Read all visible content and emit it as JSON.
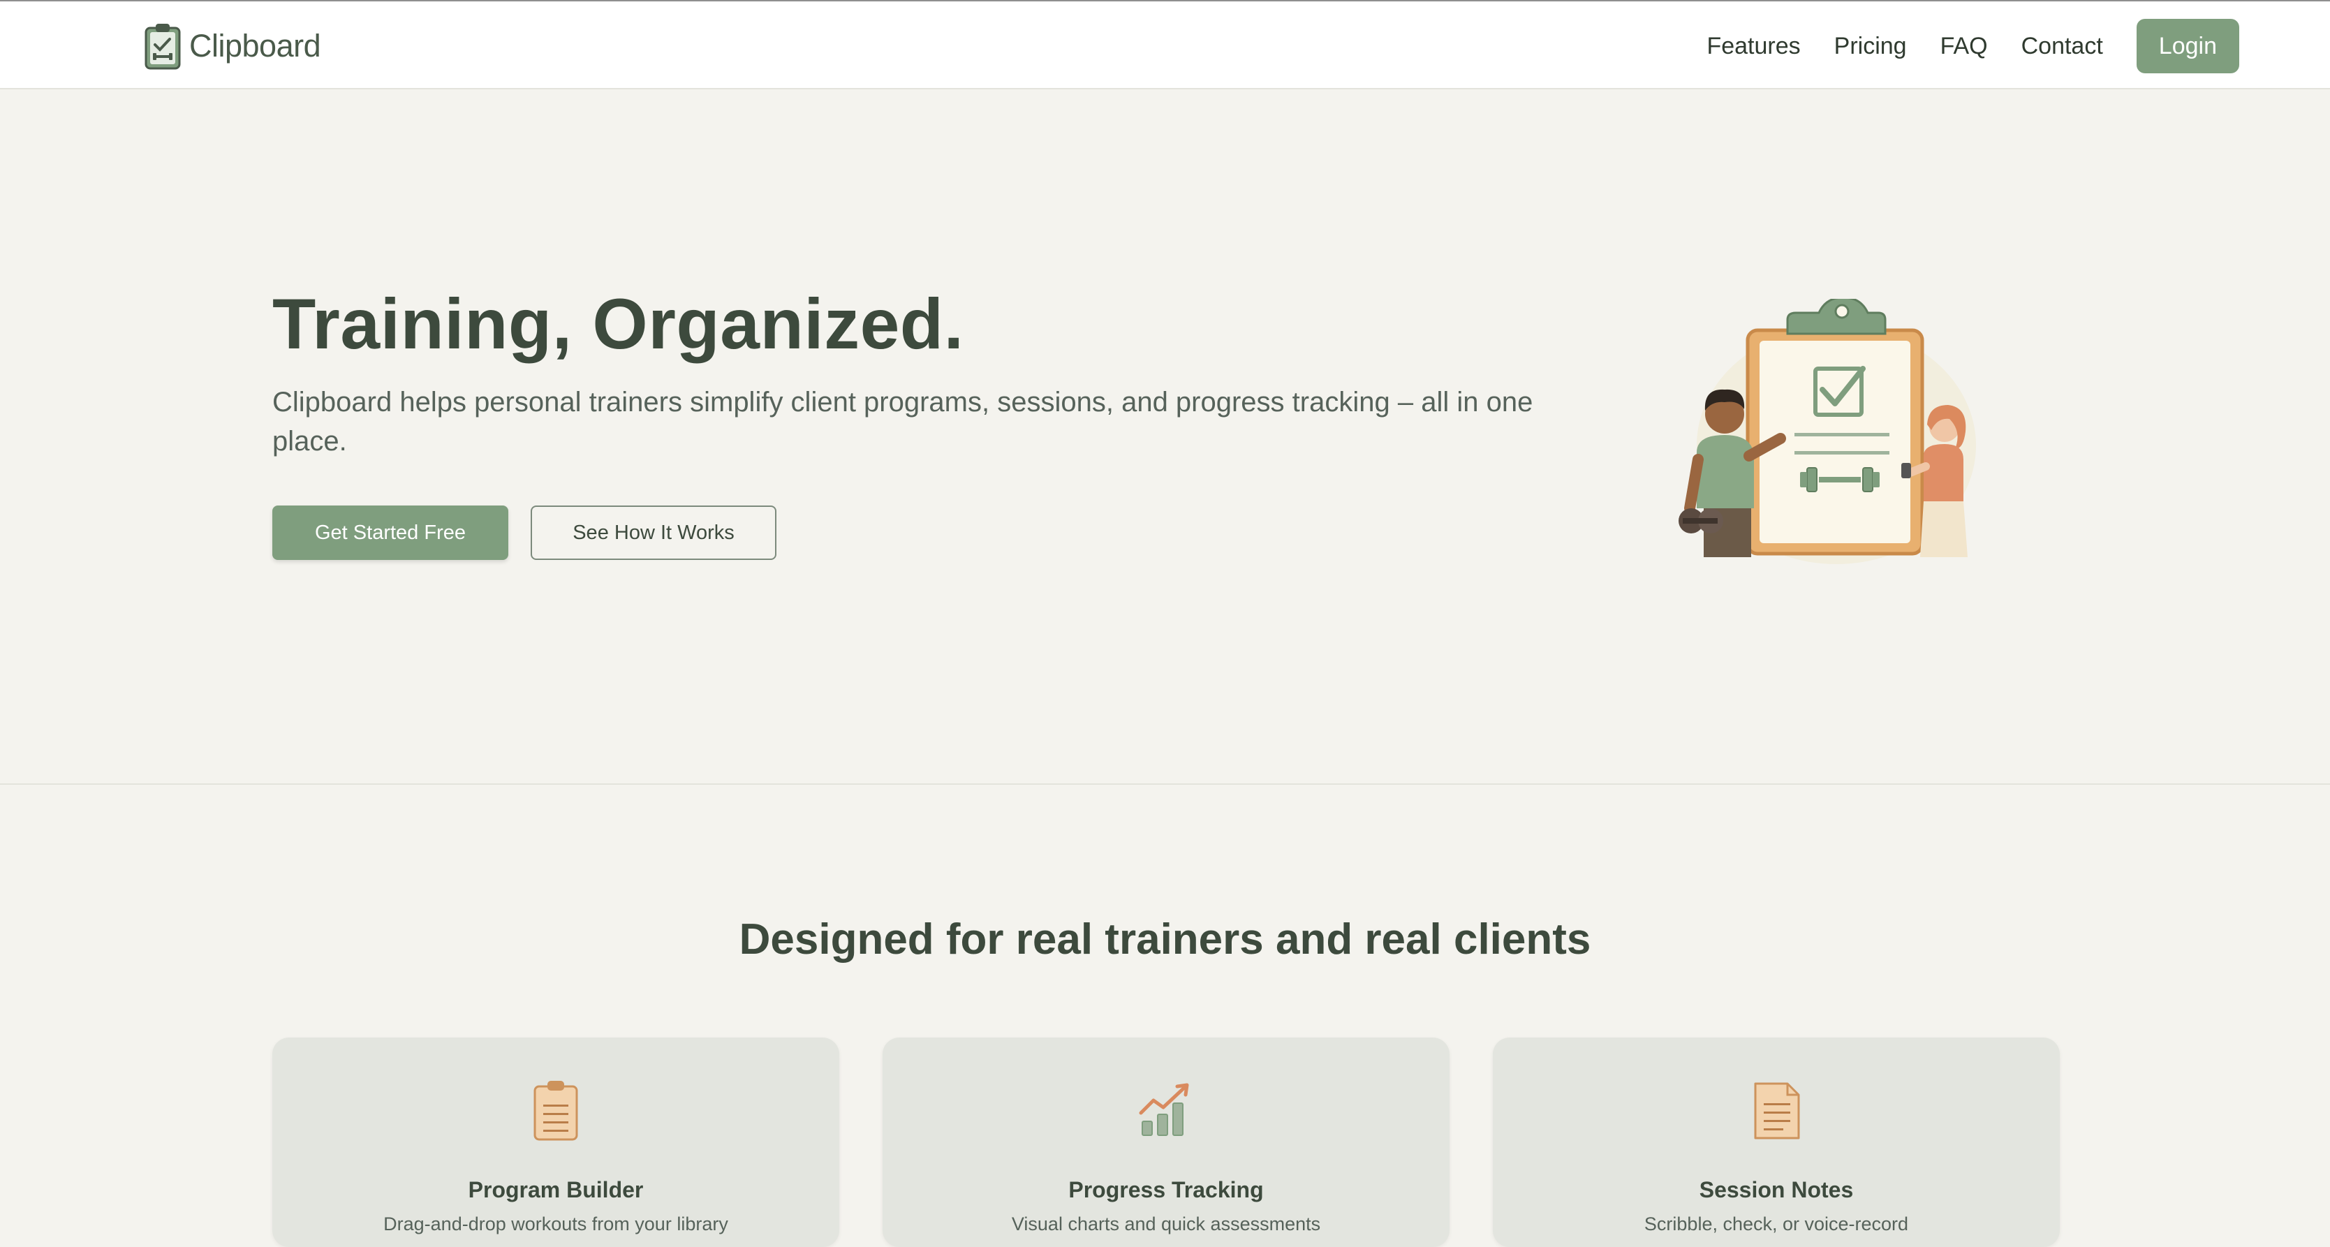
{
  "nav": {
    "logo_text": "Clipboard",
    "links": [
      "Features",
      "Pricing",
      "FAQ",
      "Contact"
    ],
    "login_label": "Login"
  },
  "hero": {
    "title": "Training, Organized.",
    "subtitle": "Clipboard helps personal trainers simplify client programs, sessions, and progress tracking – all in one place.",
    "primary_cta": "Get Started Free",
    "secondary_cta": "See How It Works"
  },
  "features": {
    "title": "Designed for real trainers and real clients",
    "cards": [
      {
        "icon": "clipboard-icon",
        "title": "Program Builder",
        "desc": "Drag-and-drop workouts from your library"
      },
      {
        "icon": "chart-icon",
        "title": "Progress Tracking",
        "desc": "Visual charts and quick assessments"
      },
      {
        "icon": "notes-icon",
        "title": "Session Notes",
        "desc": "Scribble, check, or voice-record"
      }
    ]
  },
  "colors": {
    "accent": "#7f9e7e",
    "background": "#f4f3ee",
    "card": "#e3e5df",
    "text": "#3d4a3d"
  }
}
